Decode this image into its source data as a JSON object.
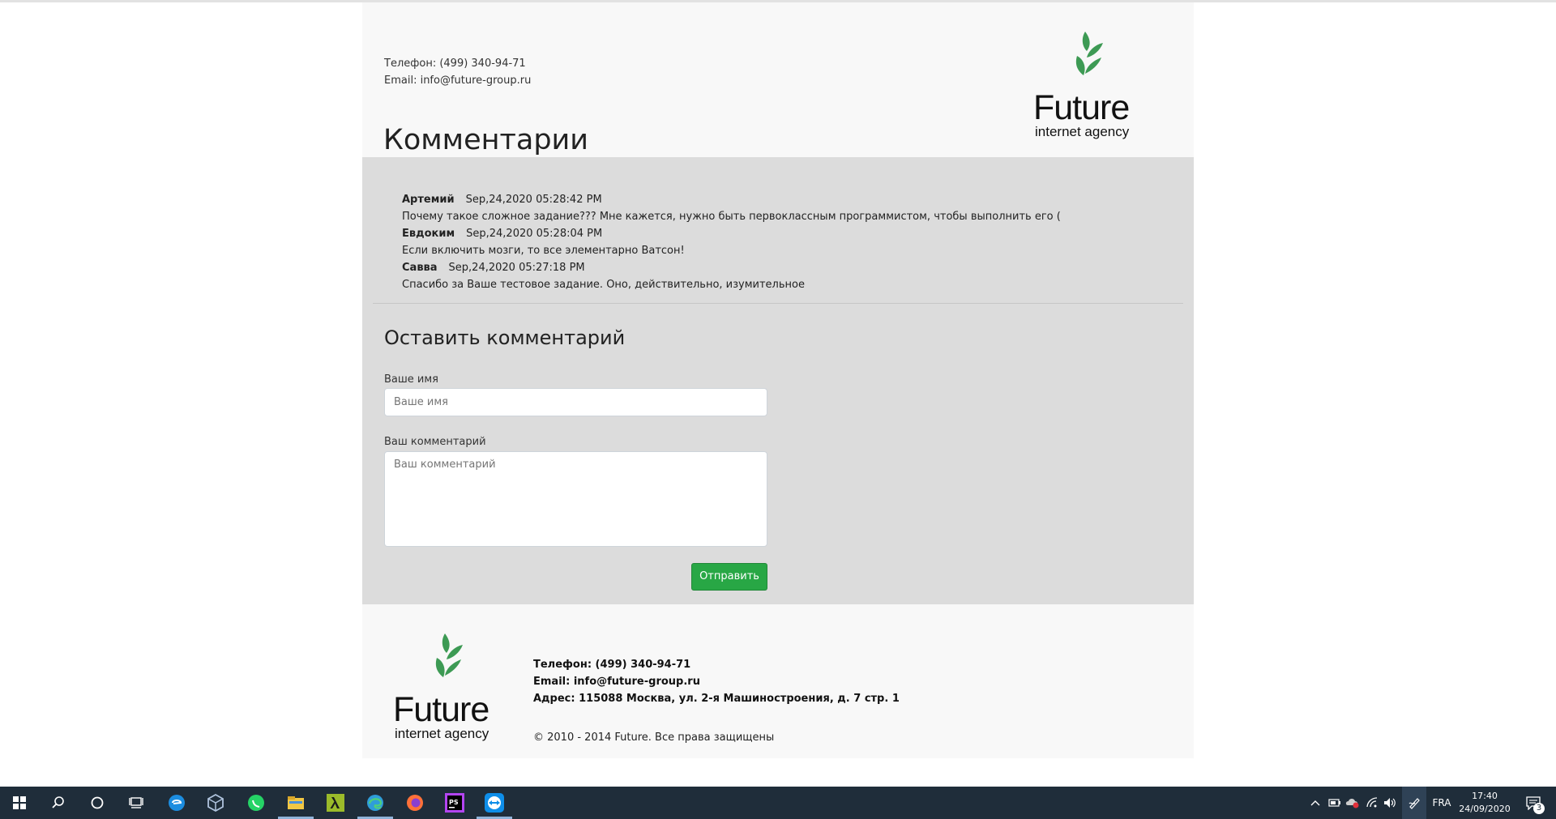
{
  "header": {
    "phone": "Телефон: (499) 340-94-71",
    "email": "Email: info@future-group.ru",
    "title": "Комментарии",
    "logo_word": "Future",
    "logo_sub": "internet agency"
  },
  "comments": [
    {
      "author": "Артемий",
      "date": "Sep,24,2020 05:28:42 PM",
      "text": "Почему такое сложное задание??? Мне кажется, нужно быть первоклассным программистом, чтобы выполнить его ("
    },
    {
      "author": "Евдоким",
      "date": "Sep,24,2020 05:28:04 PM",
      "text": "Если включить мозги, то все элементарно Ватсон!"
    },
    {
      "author": "Савва",
      "date": "Sep,24,2020 05:27:18 PM",
      "text": "Спасибо за Ваше тестовое задание. Оно, действительно, изумительное"
    }
  ],
  "form": {
    "title": "Оставить комментарий",
    "name_label": "Ваше имя",
    "name_placeholder": "Ваше имя",
    "comment_label": "Ваш комментарий",
    "comment_placeholder": "Ваш комментарий",
    "submit_label": "Отправить"
  },
  "footer": {
    "phone": "Телефон: (499) 340-94-71",
    "email": "Email: info@future-group.ru",
    "address": "Адрес: 115088 Москва, ул. 2-я Машиностроения, д. 7 стр. 1",
    "copyright": "© 2010 - 2014 Future. Все права защищены",
    "logo_word": "Future",
    "logo_sub": "internet agency"
  },
  "taskbar": {
    "icons": [
      "windows-start-icon",
      "search-icon",
      "cortana-icon",
      "task-view-icon",
      "edge-legacy-icon",
      "virtualbox-icon",
      "whatsapp-icon",
      "file-explorer-icon",
      "lambda-app-icon",
      "edge-icon",
      "firefox-icon",
      "phpstorm-icon",
      "teamviewer-icon"
    ],
    "language": "FRA",
    "time": "17:40",
    "date": "24/09/2020",
    "notification_count": "3"
  },
  "colors": {
    "accent_green": "#28a745",
    "logo_green": "#3d9a54",
    "taskbar": "#1f2d3a"
  }
}
